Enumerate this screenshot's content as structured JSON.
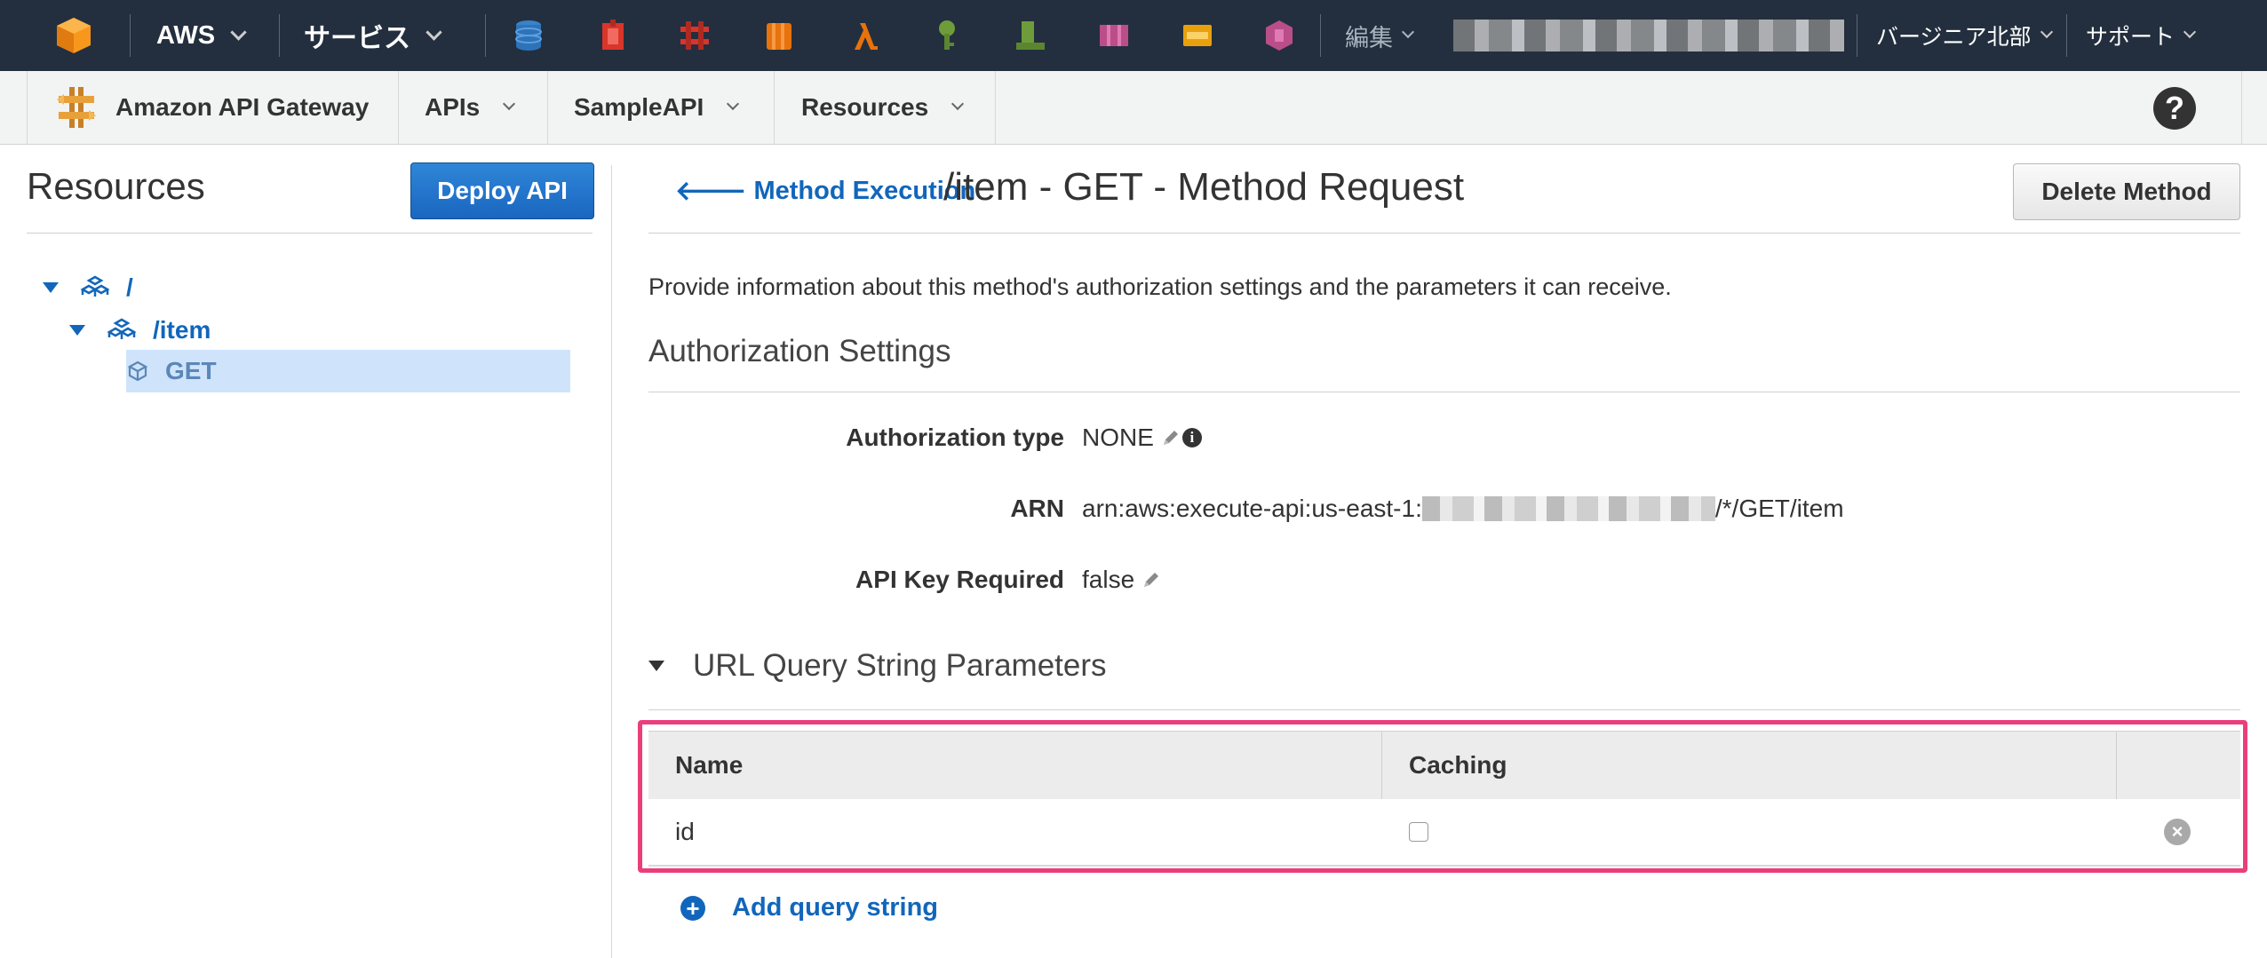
{
  "topnav": {
    "aws_label": "AWS",
    "services_label": "サービス",
    "edit_label": "編集",
    "region_label": "バージニア北部",
    "support_label": "サポート",
    "service_icons": [
      {
        "name": "database-icon",
        "color": "#2e73b8"
      },
      {
        "name": "shield-icon",
        "color": "#d9352b"
      },
      {
        "name": "network-icon",
        "color": "#d9352b"
      },
      {
        "name": "storage-icon",
        "color": "#e8720c"
      },
      {
        "name": "lambda-icon",
        "color": "#e8720c"
      },
      {
        "name": "key-icon",
        "color": "#6f9c3a"
      },
      {
        "name": "deploy-icon",
        "color": "#6f9c3a"
      },
      {
        "name": "workspaces-icon",
        "color": "#b94e8a"
      },
      {
        "name": "queue-icon",
        "color": "#e8a10c"
      },
      {
        "name": "config-icon",
        "color": "#b94e8a"
      }
    ]
  },
  "subnav": {
    "product_name": "Amazon API Gateway",
    "apis_label": "APIs",
    "api_name": "SampleAPI",
    "section_label": "Resources",
    "help_label": "?"
  },
  "left_panel": {
    "title": "Resources",
    "deploy_button": "Deploy API",
    "tree": [
      {
        "label": "/",
        "level": 0,
        "expanded": true
      },
      {
        "label": "/item",
        "level": 1,
        "expanded": true
      },
      {
        "label": "GET",
        "level": 2,
        "selected": true
      }
    ]
  },
  "header": {
    "back_link": "Method Execution",
    "title": "/item - GET - Method Request",
    "delete_button": "Delete Method"
  },
  "description": "Provide information about this method's authorization settings and the parameters it can receive.",
  "auth": {
    "section_title": "Authorization Settings",
    "type_label": "Authorization type",
    "type_value": "NONE",
    "arn_label": "ARN",
    "arn_prefix": "arn:aws:execute-api:us-east-1:",
    "arn_suffix": "/*/GET/item",
    "api_key_label": "API Key Required",
    "api_key_value": "false"
  },
  "query_params": {
    "section_title": "URL Query String Parameters",
    "columns": [
      "Name",
      "Caching"
    ],
    "rows": [
      {
        "name": "id",
        "caching": false
      }
    ],
    "add_label": "Add query string",
    "highlight_color": "#ea3e7b"
  },
  "colors": {
    "nav_bg": "#232f3e",
    "link": "#1166bb",
    "primary_button": "#1a66c0",
    "selection": "#cfe4fb"
  }
}
